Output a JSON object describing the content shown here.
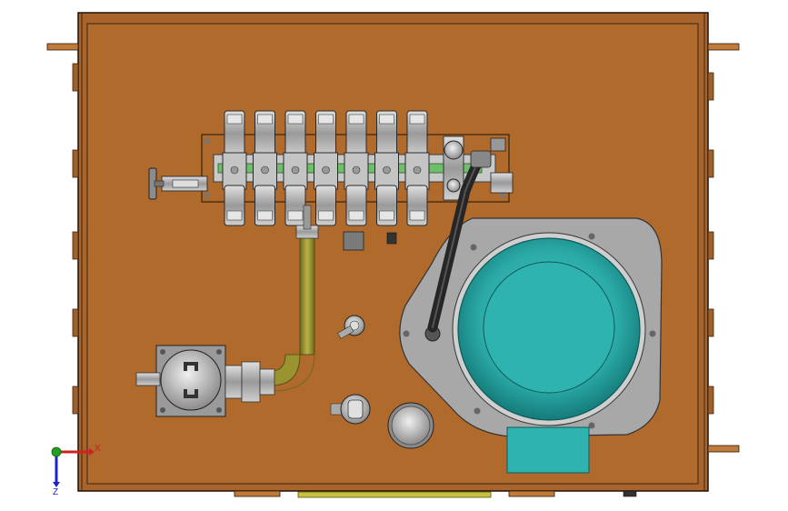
{
  "view": {
    "axis_x_label": "X",
    "axis_z_label": "Z"
  },
  "colors": {
    "background": "#ffffff",
    "tank_fill": "#b06a2c",
    "tank_edge": "#2a1a0a",
    "motor_body": "#2fb3b0",
    "motor_dark": "#1a8f8c",
    "steel": "#b8b8b8",
    "steel_dark": "#6e6e6e",
    "manifold_pipe": "#6fbf6a",
    "oil_pipe": "#8a8a2a",
    "hose": "#262626",
    "axis_x": "#d02020",
    "axis_y": "#20a020",
    "axis_z": "#2020d0"
  },
  "components": {
    "valve_count": 7,
    "components_list": [
      "oil-tank",
      "valve-manifold",
      "solenoid-valves",
      "electric-motor",
      "motor-mounting-plate",
      "suction-pipe",
      "filter-block",
      "return-hose",
      "pressure-gauge",
      "breather-cap",
      "level-gauge",
      "inlet-valve"
    ]
  }
}
